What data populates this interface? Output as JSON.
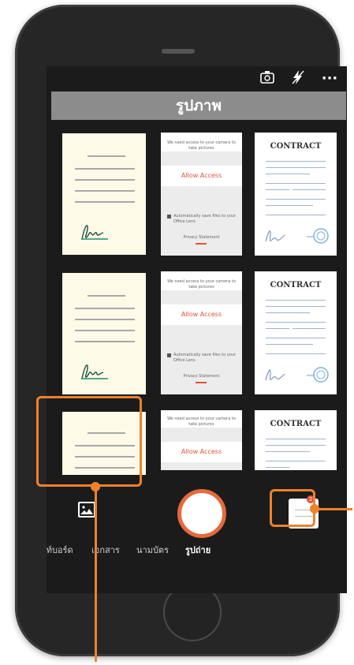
{
  "header": {
    "title": "รูปภาพ"
  },
  "top_bar": {
    "icons": [
      "camera-switch-icon",
      "flash-off-icon",
      "more-icon"
    ],
    "more_glyph": "···"
  },
  "thumbnails": {
    "app_screen": {
      "prompt": "We need access to your camera to take pictures",
      "allow_label": "Allow Access",
      "checkbox_text": "Automatically save files to your Office Lens",
      "privacy_label": "Privacy Statement"
    },
    "contract": {
      "title": "CONTRACT"
    }
  },
  "capture_modes": [
    "ไวท์บอร์ด",
    "เอกสาร",
    "นามบัตร",
    "รูปถ่าย"
  ],
  "active_mode": "รูปถ่าย",
  "recent_capture": {
    "count": "2"
  },
  "colors": {
    "accent": "#f0812b",
    "allow_text": "#e2523a",
    "title_bar": "#8c8c8c"
  }
}
